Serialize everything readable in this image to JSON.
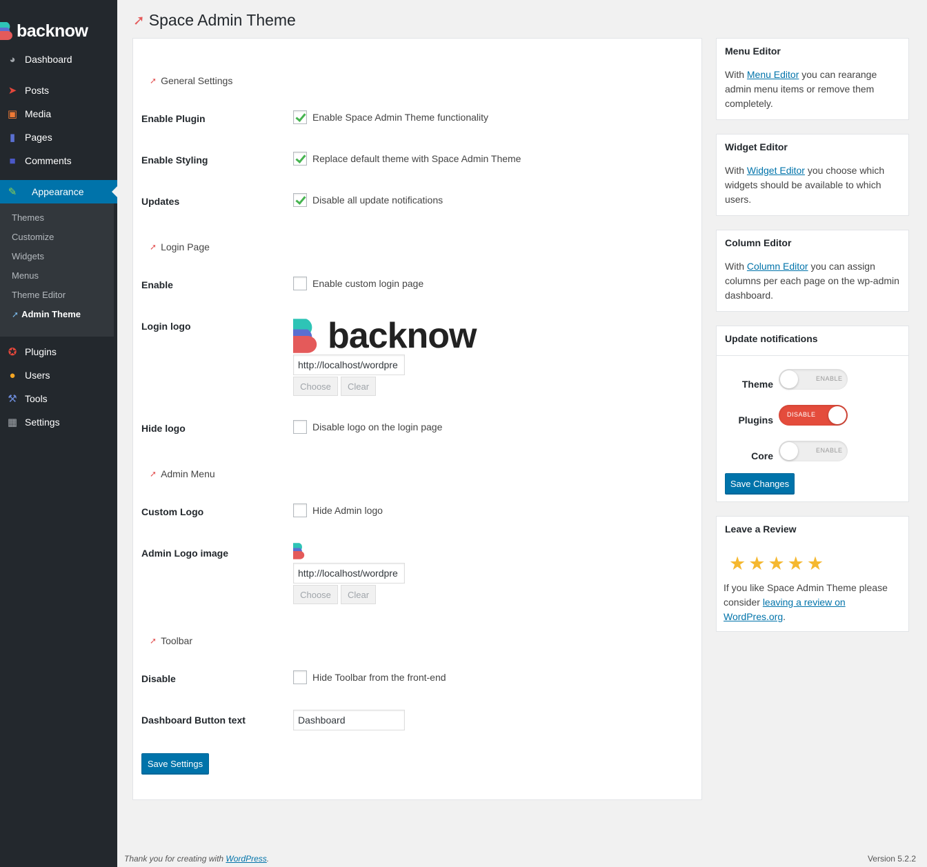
{
  "brand": {
    "name": "backnow",
    "colors": {
      "teal": "#2ec4b6",
      "blue": "#4a6fd1",
      "red": "#e45a5a"
    }
  },
  "sidebar": {
    "items": [
      {
        "label": "Dashboard",
        "icon": "dashboard-icon"
      },
      {
        "label": "Posts",
        "icon": "pin-icon"
      },
      {
        "label": "Media",
        "icon": "media-icon"
      },
      {
        "label": "Pages",
        "icon": "pages-icon"
      },
      {
        "label": "Comments",
        "icon": "comments-icon"
      },
      {
        "label": "Appearance",
        "icon": "brush-icon",
        "active": true
      },
      {
        "label": "Plugins",
        "icon": "plugin-icon"
      },
      {
        "label": "Users",
        "icon": "users-icon"
      },
      {
        "label": "Tools",
        "icon": "wrench-icon"
      },
      {
        "label": "Settings",
        "icon": "settings-icon"
      }
    ],
    "submenu": [
      "Themes",
      "Customize",
      "Widgets",
      "Menus",
      "Theme Editor",
      "Admin Theme"
    ],
    "accent": "#0073aa"
  },
  "page": {
    "title": "Space Admin Theme"
  },
  "sections": {
    "general": "General Settings",
    "login": "Login Page",
    "admin_menu": "Admin Menu",
    "toolbar": "Toolbar"
  },
  "fields": {
    "enable_plugin": {
      "label": "Enable Plugin",
      "text": "Enable Space Admin Theme functionality",
      "checked": true
    },
    "enable_styling": {
      "label": "Enable Styling",
      "text": "Replace default theme with Space Admin Theme",
      "checked": true
    },
    "updates": {
      "label": "Updates",
      "text": "Disable all update notifications",
      "checked": true
    },
    "login_enable": {
      "label": "Enable",
      "text": "Enable custom login page",
      "checked": false
    },
    "login_logo": {
      "label": "Login logo",
      "url": "http://localhost/wordpre",
      "choose": "Choose",
      "clear": "Clear"
    },
    "hide_logo": {
      "label": "Hide logo",
      "text": "Disable logo on the login page",
      "checked": false
    },
    "custom_logo": {
      "label": "Custom Logo",
      "text": "Hide Admin logo",
      "checked": false
    },
    "admin_logo": {
      "label": "Admin Logo image",
      "url": "http://localhost/wordpre",
      "choose": "Choose",
      "clear": "Clear"
    },
    "toolbar_disable": {
      "label": "Disable",
      "text": "Hide Toolbar from the front-end",
      "checked": false
    },
    "dashboard_button": {
      "label": "Dashboard Button text",
      "value": "Dashboard"
    }
  },
  "save_settings": "Save Settings",
  "widgets": {
    "menu_editor": {
      "title": "Menu Editor",
      "pre": "With ",
      "link": "Menu Editor",
      "post": " you can rearange admin menu items or remove them completely."
    },
    "widget_editor": {
      "title": "Widget Editor",
      "pre": "With ",
      "link": "Widget Editor",
      "post": " you choose which widgets should be available to which users."
    },
    "column_editor": {
      "title": "Column Editor",
      "pre": "With ",
      "link": "Column Editor",
      "post": " you can assign columns per each page on the wp-admin dashboard."
    },
    "updates": {
      "title": "Update notifications",
      "toggles": [
        {
          "label": "Theme",
          "state": "ENABLE",
          "on": false
        },
        {
          "label": "Plugins",
          "state": "DISABLE",
          "on": true
        },
        {
          "label": "Core",
          "state": "ENABLE",
          "on": false
        }
      ],
      "save": "Save Changes"
    },
    "review": {
      "title": "Leave a Review",
      "stars": 5,
      "pre": "If you like Space Admin Theme please consider ",
      "link": "leaving a review on WordPres.org",
      "post": "."
    }
  },
  "footer": {
    "left_pre": "Thank you for creating with ",
    "left_link": "WordPress",
    "left_post": ".",
    "version": "Version 5.2.2"
  }
}
